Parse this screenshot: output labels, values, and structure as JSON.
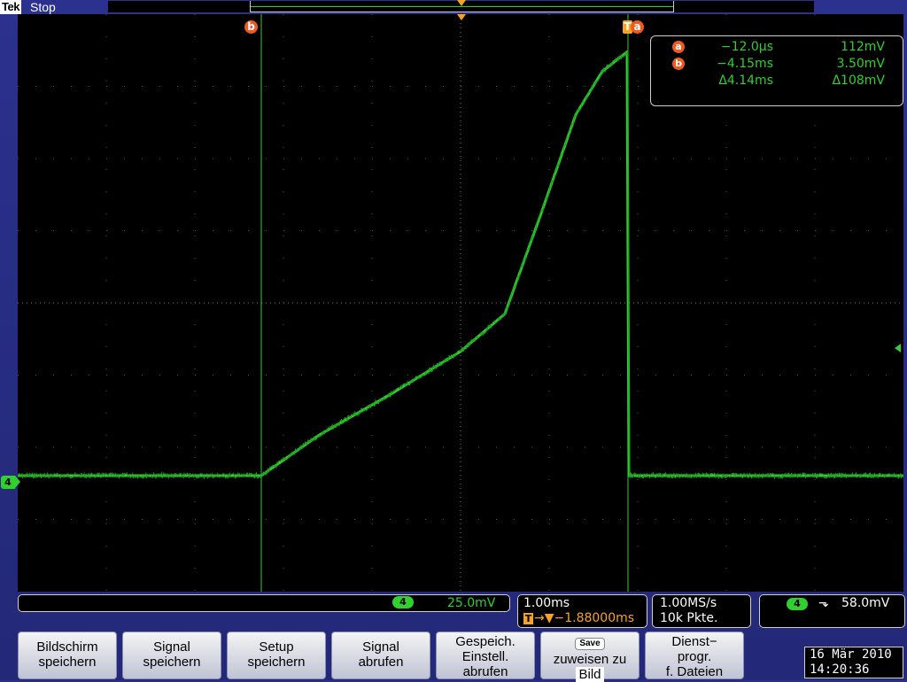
{
  "top_bar": {
    "brand": "Tek",
    "status": "Stop"
  },
  "cursors": {
    "a_label": "a",
    "b_label": "b",
    "trigger_label": "T",
    "readout": [
      {
        "badge": "a",
        "time": "−12.0µs",
        "value": "112mV"
      },
      {
        "badge": "b",
        "time": "−4.15ms",
        "value": "3.50mV"
      },
      {
        "badge": "",
        "time": "Δ4.14ms",
        "value": "Δ108mV"
      }
    ]
  },
  "channel_marker": "4",
  "bottom_info": {
    "channel_badge": "4",
    "channel_scale": "25.0mV",
    "timebase": "1.00ms",
    "trigger_position": "→▼−1.88000ms",
    "trigger_badge": "T",
    "sample_rate": "1.00MS/s",
    "record_length": "10k Pkte.",
    "trigger_channel": "4",
    "trigger_slope": "⬎",
    "trigger_level": "58.0mV"
  },
  "softkeys": [
    {
      "id": "bildschirm",
      "lines": [
        "Bildschirm",
        "speichern"
      ]
    },
    {
      "id": "signal-speichern",
      "lines": [
        "Signal",
        "speichern"
      ]
    },
    {
      "id": "setup",
      "lines": [
        "Setup",
        "speichern"
      ]
    },
    {
      "id": "signal-abrufen",
      "lines": [
        "Signal",
        "abrufen"
      ]
    },
    {
      "id": "gespeich",
      "lines": [
        "Gespeich.",
        "Einstell.",
        "abrufen"
      ]
    },
    {
      "id": "save",
      "badge": "Save",
      "lines": [
        "zuweisen zu",
        "Bild"
      ]
    },
    {
      "id": "dienst",
      "lines": [
        "Dienst−",
        "progr.",
        "f. Dateien"
      ]
    }
  ],
  "date": "16 Mär 2010",
  "time": "14:20:36",
  "colors": {
    "trace": "#2fd02f",
    "cursor": "#2fd02f",
    "cursor_badge": "#f2591e",
    "trigger": "#f7a325",
    "background": "#2b318e"
  },
  "trace": {
    "time_per_div_ms": 1.0,
    "volts_per_div_mv": 25.0,
    "points": [
      [
        0,
        0
      ],
      [
        4.15,
        0
      ],
      [
        5.0,
        22
      ],
      [
        6.0,
        42
      ],
      [
        6.5,
        56
      ],
      [
        7.0,
        75
      ],
      [
        7.5,
        93
      ],
      [
        8.0,
        106
      ],
      [
        8.3,
        110
      ],
      [
        8.32,
        0
      ],
      [
        10,
        0
      ]
    ]
  }
}
